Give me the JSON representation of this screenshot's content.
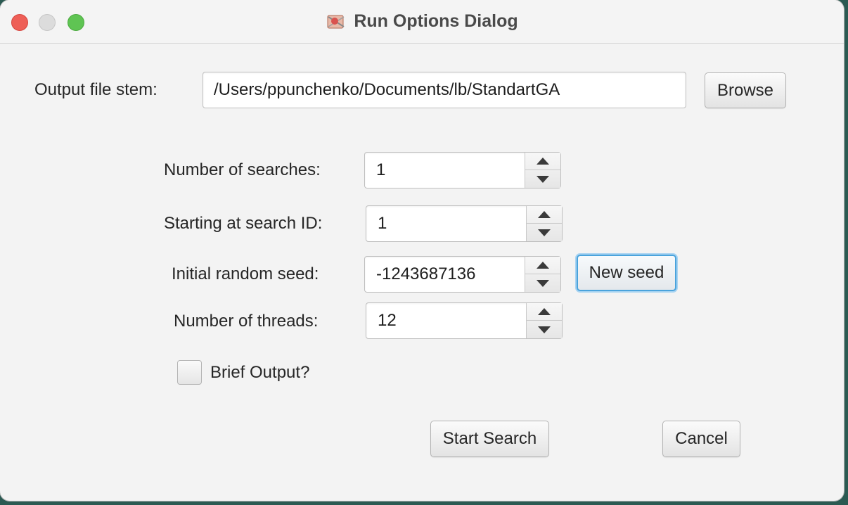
{
  "window": {
    "title": "Run Options Dialog",
    "icon": "app-icon"
  },
  "output_file": {
    "label": "Output file stem:",
    "value": "/Users/ppunchenko/Documents/lb/StandartGA",
    "browse_label": "Browse"
  },
  "searches": {
    "label": "Number of searches:",
    "value": "1"
  },
  "start_id": {
    "label": "Starting at search ID:",
    "value": "1"
  },
  "seed": {
    "label": "Initial random seed:",
    "value": "-1243687136",
    "new_seed_label": "New seed"
  },
  "threads": {
    "label": "Number of threads:",
    "value": "12"
  },
  "brief_output": {
    "label": "Brief Output?",
    "checked": false
  },
  "actions": {
    "start_label": "Start Search",
    "cancel_label": "Cancel"
  },
  "colors": {
    "close": "#ee5f57",
    "minimize": "#dcdcdc",
    "maximize": "#5fc453",
    "focus_ring": "#4aa3dc"
  }
}
